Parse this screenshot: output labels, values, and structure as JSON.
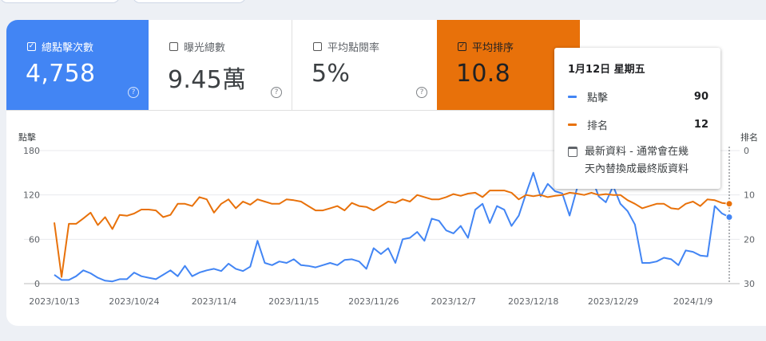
{
  "cards": {
    "clicks": {
      "label": "總點擊次數",
      "value": "4,758",
      "checked": true
    },
    "impressions": {
      "label": "曝光總數",
      "value": "9.45萬",
      "checked": false
    },
    "ctr": {
      "label": "平均點閱率",
      "value": "5%",
      "checked": false
    },
    "position": {
      "label": "平均排序",
      "value": "10.8",
      "checked": true
    }
  },
  "colors": {
    "clicks": "#4285f4",
    "position": "#e8710a"
  },
  "tooltip": {
    "date": "1月12日 星期五",
    "rows": [
      {
        "name": "點擊",
        "value": "90"
      },
      {
        "name": "排名",
        "value": "12"
      }
    ],
    "note_line1": "最新資料 - 通常會在幾",
    "note_line2": "天內替換成最終版資料"
  },
  "chart_data": {
    "type": "line",
    "xlabel": "",
    "x_ticks": [
      "2023/10/13",
      "2023/10/24",
      "2023/11/4",
      "2023/11/15",
      "2023/11/26",
      "2023/12/7",
      "2023/12/18",
      "2023/12/29",
      "2024/1/9"
    ],
    "start_date": "2023/10/13",
    "end_date": "2024/1/12",
    "grid": true,
    "axes": {
      "left": {
        "label": "點擊",
        "ticks": [
          0,
          60,
          120,
          180
        ],
        "ylim": [
          0,
          180
        ]
      },
      "right": {
        "label": "排名",
        "ticks": [
          0,
          10,
          20,
          30
        ],
        "ylim": [
          0,
          30
        ],
        "inverted": true
      }
    },
    "series": [
      {
        "name": "點擊",
        "axis": "left",
        "color": "#4285f4",
        "values": [
          12,
          5,
          5,
          10,
          18,
          14,
          8,
          4,
          3,
          6,
          6,
          15,
          10,
          8,
          6,
          12,
          18,
          10,
          24,
          10,
          15,
          18,
          20,
          17,
          27,
          20,
          17,
          23,
          58,
          28,
          25,
          30,
          28,
          33,
          25,
          24,
          22,
          25,
          28,
          25,
          32,
          33,
          30,
          20,
          48,
          40,
          48,
          28,
          60,
          62,
          70,
          58,
          88,
          85,
          72,
          68,
          78,
          62,
          100,
          108,
          82,
          105,
          100,
          78,
          92,
          122,
          150,
          118,
          135,
          125,
          122,
          92,
          128,
          150,
          145,
          118,
          110,
          132,
          108,
          98,
          80,
          28,
          28,
          30,
          35,
          33,
          25,
          45,
          43,
          38,
          37,
          105,
          95,
          90
        ]
      },
      {
        "name": "排名",
        "axis": "right",
        "color": "#e8710a",
        "values": [
          16.2,
          28.5,
          16.5,
          16.5,
          15.3,
          14.0,
          16.8,
          15.0,
          17.7,
          14.5,
          14.7,
          14.2,
          13.3,
          13.3,
          13.5,
          15.0,
          14.5,
          12.0,
          12.0,
          12.5,
          10.5,
          11.0,
          14.0,
          12.0,
          11.0,
          13.0,
          11.5,
          12.2,
          11.0,
          11.5,
          12.0,
          12.0,
          11.0,
          11.2,
          11.5,
          12.5,
          13.5,
          13.5,
          13.0,
          12.5,
          13.5,
          11.8,
          12.5,
          12.7,
          13.5,
          12.5,
          11.5,
          11.8,
          11.0,
          11.5,
          10.0,
          10.5,
          11.0,
          11.0,
          10.5,
          9.8,
          10.2,
          9.7,
          9.5,
          10.5,
          9.0,
          9.0,
          9.0,
          9.5,
          11.0,
          10.0,
          10.3,
          10.0,
          10.5,
          10.2,
          10.0,
          9.5,
          9.7,
          10.0,
          9.5,
          10.0,
          9.8,
          10.0,
          10.0,
          11.2,
          12.0,
          13.0,
          12.5,
          12.0,
          12.0,
          13.0,
          13.2,
          12.0,
          11.5,
          12.5,
          11.0,
          11.2,
          11.8,
          12.0
        ]
      }
    ],
    "highlight": {
      "index": 93,
      "label": "1月12日 星期五"
    }
  }
}
